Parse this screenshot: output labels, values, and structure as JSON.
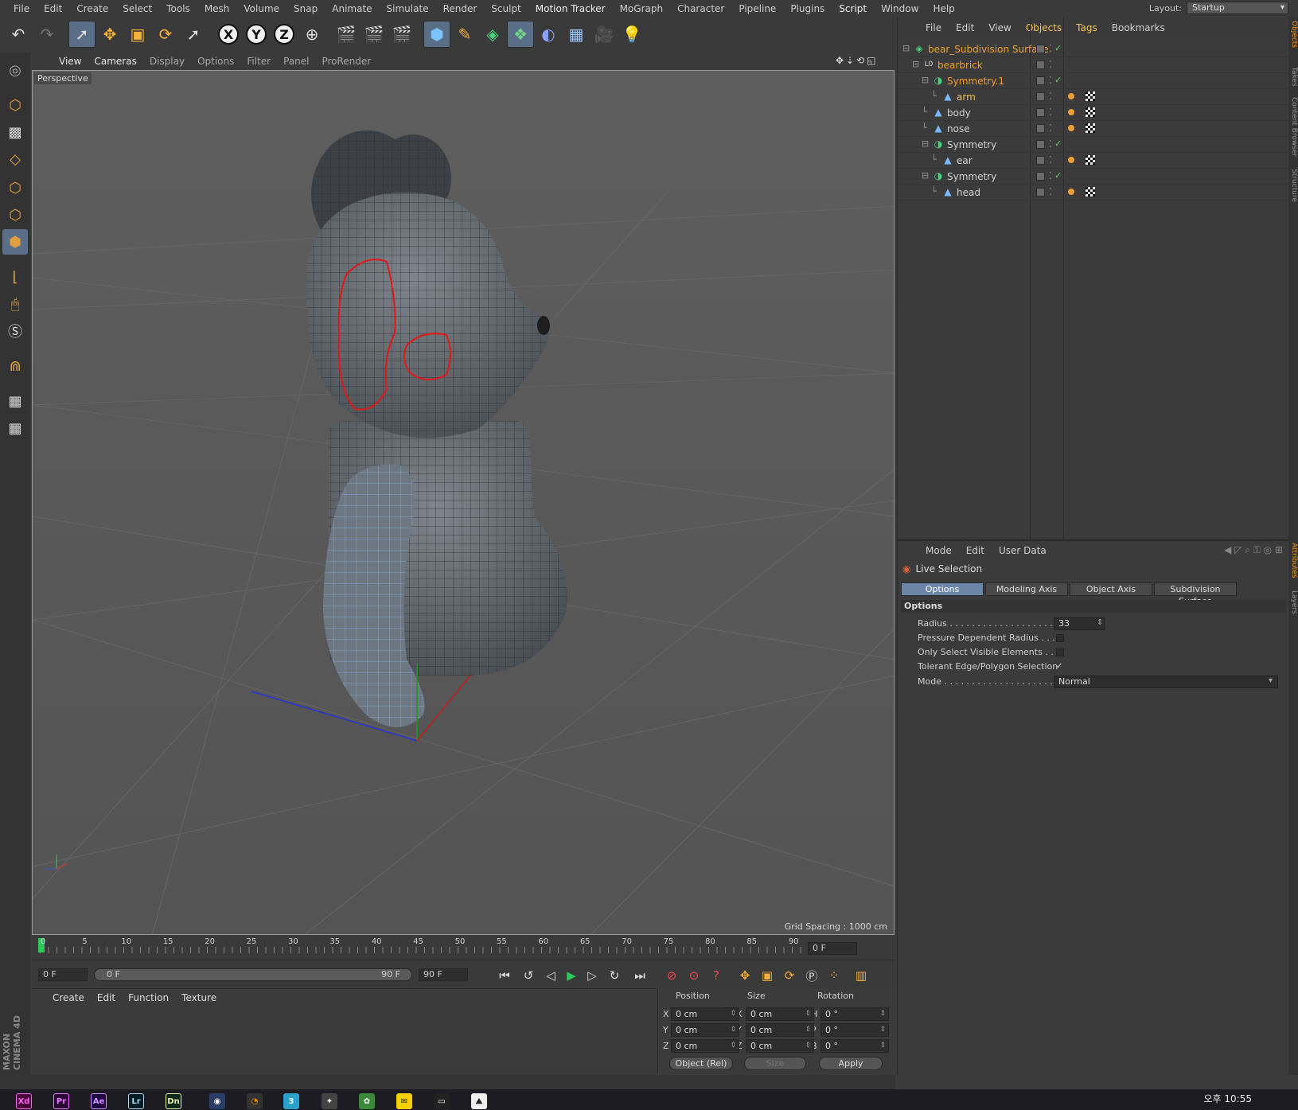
{
  "menu": [
    "File",
    "Edit",
    "Create",
    "Select",
    "Tools",
    "Mesh",
    "Volume",
    "Snap",
    "Animate",
    "Simulate",
    "Render",
    "Sculpt",
    "Motion Tracker",
    "MoGraph",
    "Character",
    "Pipeline",
    "Plugins",
    "Script",
    "Window",
    "Help"
  ],
  "layout": {
    "label": "Layout:",
    "value": "Startup"
  },
  "viewport": {
    "menu": [
      "View",
      "Cameras",
      "Display",
      "Options",
      "Filter",
      "Panel",
      "ProRender"
    ],
    "label": "Perspective",
    "grid_spacing": "Grid Spacing : 1000 cm"
  },
  "timeline": {
    "ticks": [
      "0",
      "5",
      "10",
      "15",
      "20",
      "25",
      "30",
      "35",
      "40",
      "45",
      "50",
      "55",
      "60",
      "65",
      "70",
      "75",
      "80",
      "85",
      "90"
    ],
    "frame_right": "0 F"
  },
  "transport": {
    "start": "0 F",
    "range_left": "0 F",
    "range_right": "90 F",
    "end": "90 F"
  },
  "material": {
    "menu": [
      "Create",
      "Edit",
      "Function",
      "Texture"
    ]
  },
  "coords": {
    "headers": [
      "Position",
      "Size",
      "Rotation"
    ],
    "rows": [
      {
        "a": "X",
        "pos": "0 cm",
        "b": "X",
        "size": "0 cm",
        "c": "H",
        "rot": "0 °"
      },
      {
        "a": "Y",
        "pos": "0 cm",
        "b": "Y",
        "size": "0 cm",
        "c": "P",
        "rot": "0 °"
      },
      {
        "a": "Z",
        "pos": "0 cm",
        "b": "Z",
        "size": "0 cm",
        "c": "B",
        "rot": "0 °"
      }
    ],
    "mode": "Object (Rel)",
    "size_mode": "Size",
    "apply": "Apply"
  },
  "objects": {
    "menu": [
      "File",
      "Edit",
      "View",
      "Objects",
      "Tags",
      "Bookmarks"
    ],
    "items": [
      {
        "name": "bear_Subdivision Surface",
        "depth": 0,
        "icon": "subdiv",
        "style": "orange",
        "check": true,
        "tags": false
      },
      {
        "name": "bearbrick",
        "depth": 1,
        "icon": "null",
        "style": "orange",
        "check": false,
        "tags": false
      },
      {
        "name": "Symmetry.1",
        "depth": 2,
        "icon": "symmetry",
        "style": "orange",
        "check": true,
        "tags": false
      },
      {
        "name": "arm",
        "depth": 3,
        "icon": "poly",
        "style": "hl",
        "check": false,
        "tags": true
      },
      {
        "name": "body",
        "depth": 2,
        "icon": "poly",
        "style": "",
        "check": false,
        "tags": true
      },
      {
        "name": "nose",
        "depth": 2,
        "icon": "poly",
        "style": "",
        "check": false,
        "tags": true
      },
      {
        "name": "Symmetry",
        "depth": 2,
        "icon": "symmetry",
        "style": "",
        "check": true,
        "tags": false
      },
      {
        "name": "ear",
        "depth": 3,
        "icon": "poly",
        "style": "",
        "check": false,
        "tags": true
      },
      {
        "name": "Symmetry",
        "depth": 2,
        "icon": "symmetry",
        "style": "",
        "check": true,
        "tags": false
      },
      {
        "name": "head",
        "depth": 3,
        "icon": "poly",
        "style": "",
        "check": false,
        "tags": true
      }
    ]
  },
  "attributes": {
    "menu": [
      "Mode",
      "Edit",
      "User Data"
    ],
    "tool": "Live Selection",
    "tabs": [
      "Options",
      "Modeling Axis",
      "Object Axis",
      "Subdivision Surface"
    ],
    "section": "Options",
    "fields": [
      {
        "label": "Radius . . . . . . . . . . . . . . . . . . . . .",
        "value": "33"
      },
      {
        "label": "Pressure Dependent Radius . . . .",
        "checked": false
      },
      {
        "label": "Only Select Visible Elements . . .",
        "checked": false
      },
      {
        "label": "Tolerant Edge/Polygon Selection",
        "checked": true
      },
      {
        "label": "Mode . . . . . . . . . . . . . . . . . . . . . . .",
        "value": "Normal"
      }
    ]
  },
  "right_tabs": [
    "Objects",
    "Takes",
    "Content Browser",
    "Structure",
    "Attributes",
    "Layers"
  ],
  "taskbar": {
    "apps": [
      {
        "label": "Xd",
        "color": "#ff61f6",
        "bg": "#470137"
      },
      {
        "label": "Pr",
        "color": "#ea77ff",
        "bg": "#2a0634"
      },
      {
        "label": "Ae",
        "color": "#d291ff",
        "bg": "#1f0740"
      },
      {
        "label": "Lr",
        "color": "#add5ec",
        "bg": "#001d26"
      },
      {
        "label": "Dn",
        "color": "#e9f2a4",
        "bg": "#0b2a1d"
      }
    ],
    "time": "오후 10:55"
  },
  "brand": "MAXON CINEMA 4D",
  "colors": {
    "accent": "#5a6f87",
    "orange": "#f0a030",
    "selection": "#e01818"
  }
}
